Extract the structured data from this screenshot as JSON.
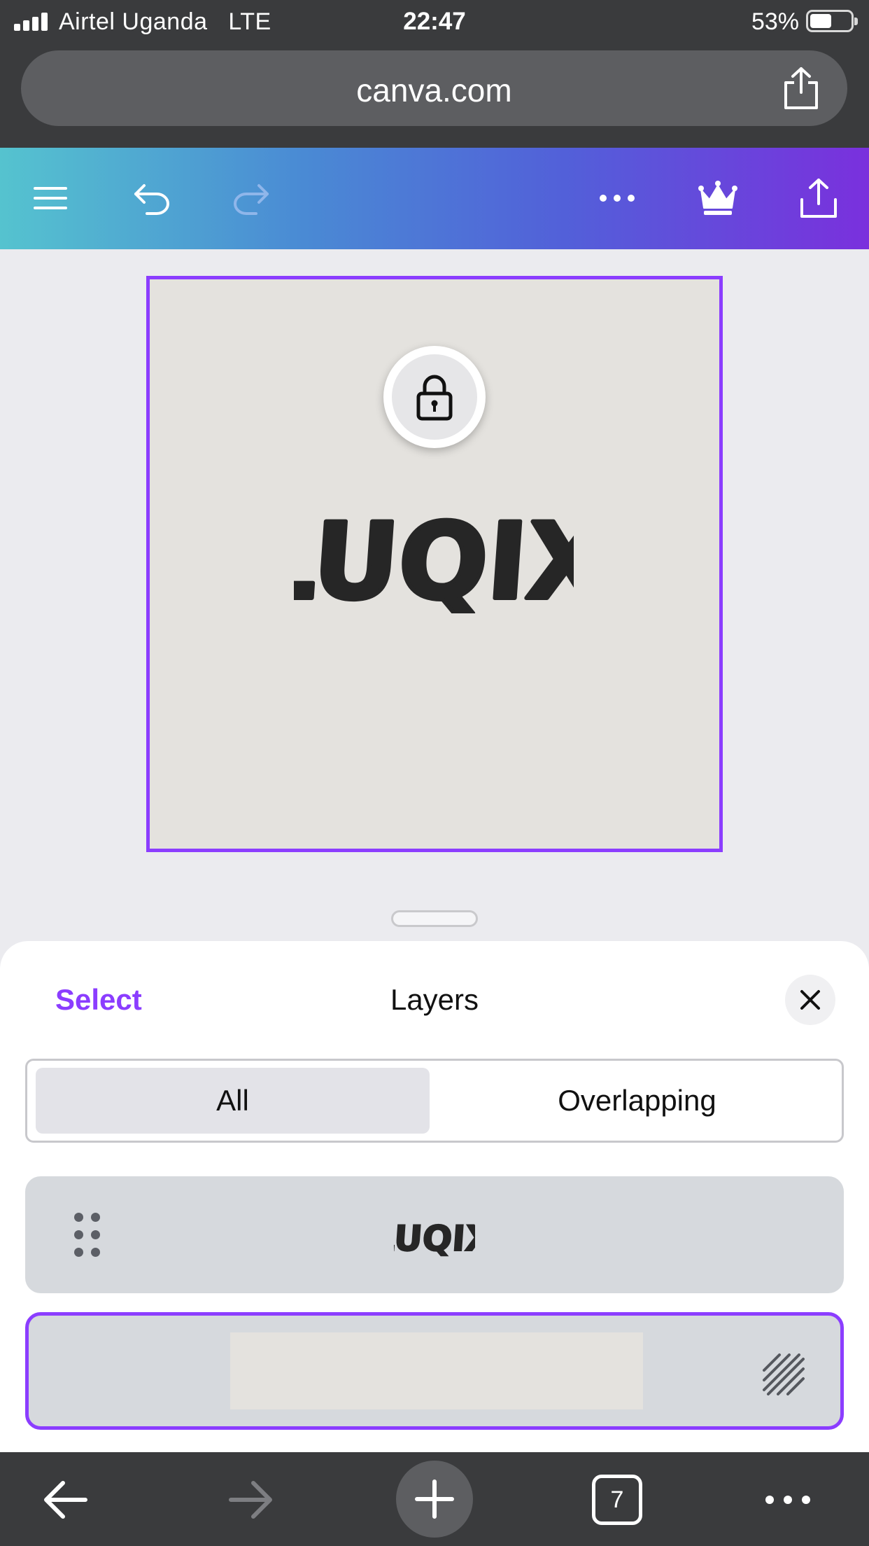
{
  "status_bar": {
    "carrier": "Airtel Uganda",
    "network": "LTE",
    "time": "22:47",
    "battery_percent": "53%"
  },
  "browser": {
    "url": "canva.com"
  },
  "toolbar": {
    "icons": [
      "menu-icon",
      "undo-icon",
      "redo-icon",
      "more-icon",
      "crown-icon",
      "share-icon"
    ],
    "gradient": [
      "#55c3cf",
      "#4a8ad4",
      "#5260d9",
      "#7a30dd"
    ]
  },
  "canvas": {
    "logo_text": "LUQIX",
    "background_color": "#e4e2de",
    "selection_color": "#8b3dff"
  },
  "layers_panel": {
    "select_label": "Select",
    "title": "Layers",
    "tabs": [
      {
        "label": "All",
        "selected": true
      },
      {
        "label": "Overlapping",
        "selected": false
      }
    ],
    "layers": [
      {
        "name": "LUQIX",
        "type": "text-logo"
      },
      {
        "name": "background",
        "type": "background",
        "selected": true
      }
    ]
  },
  "bottom_bar": {
    "tab_count": "7",
    "icons": [
      "back-arrow-icon",
      "forward-arrow-icon",
      "new-tab-plus-icon",
      "tabs-icon",
      "more-icon"
    ]
  }
}
